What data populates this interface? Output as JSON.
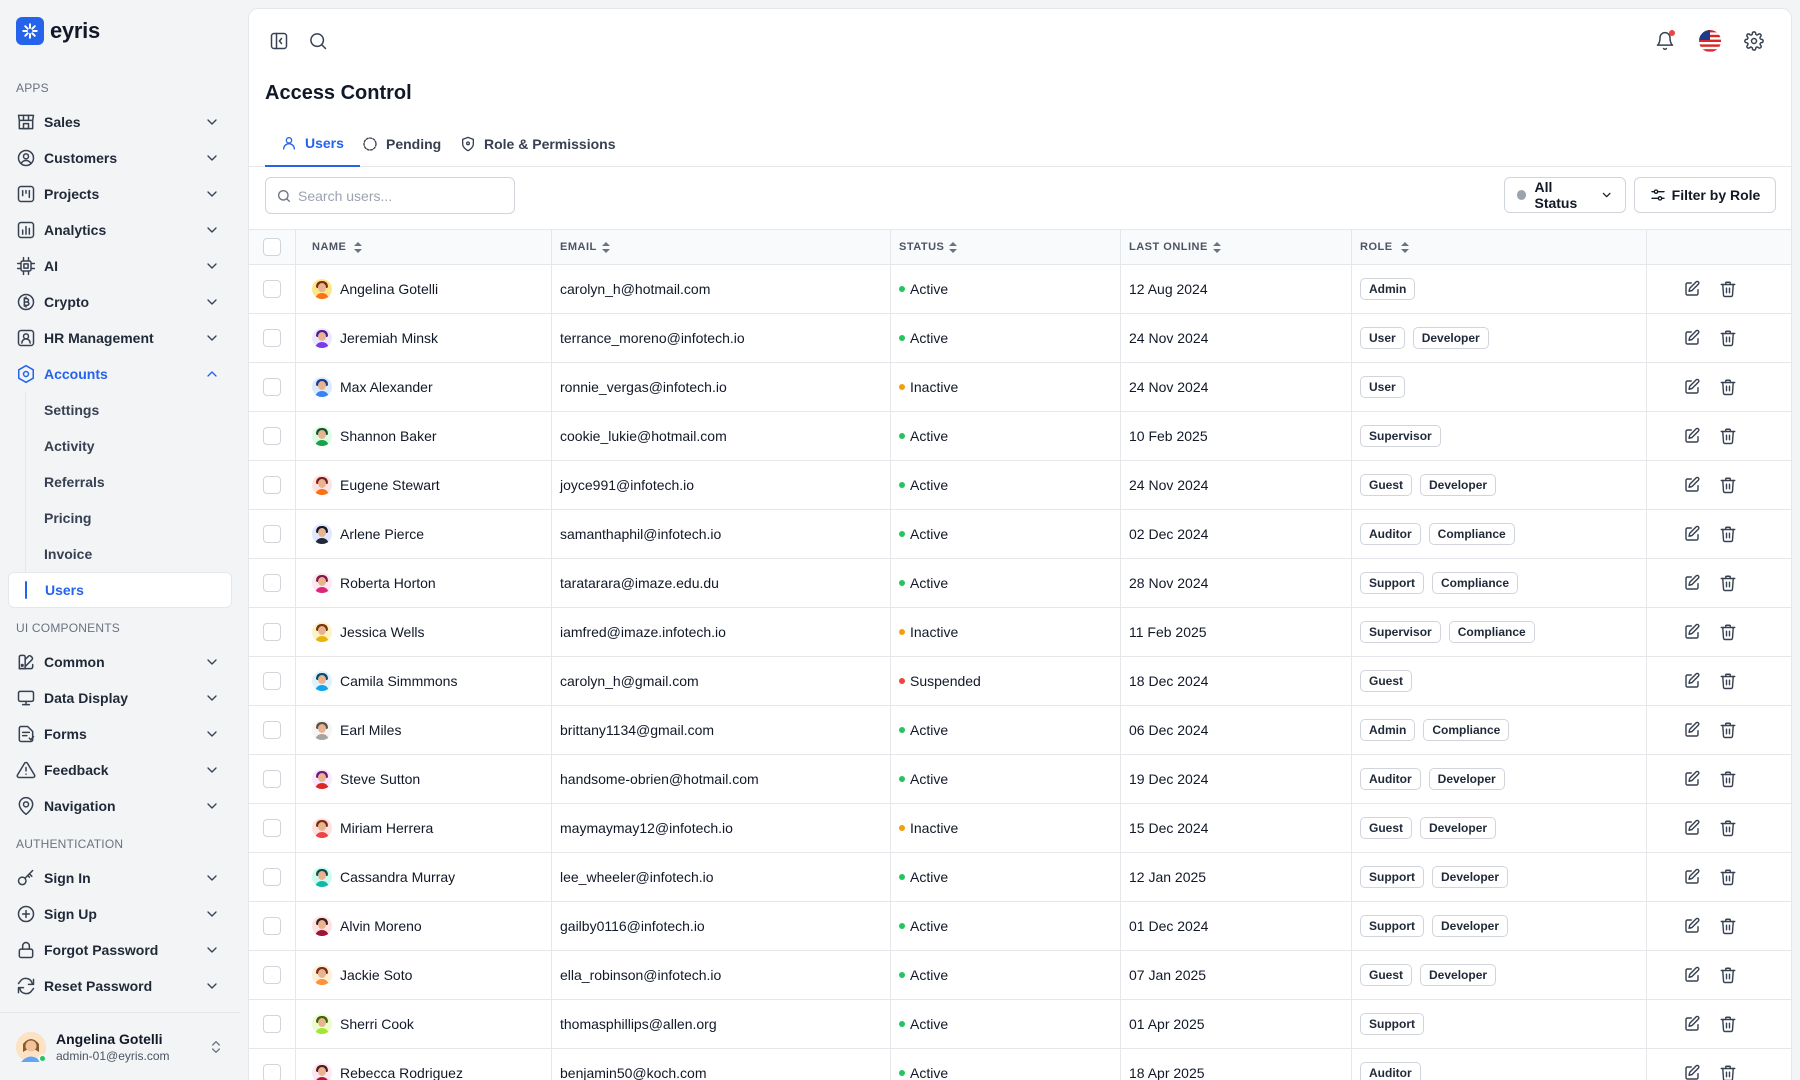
{
  "brand": {
    "name": "eyris"
  },
  "sidebar": {
    "sections": {
      "apps": "APPS",
      "ui_components": "UI COMPONENTS",
      "authentication": "AUTHENTICATION"
    },
    "apps": [
      {
        "label": "Sales",
        "icon": "store-icon"
      },
      {
        "label": "Customers",
        "icon": "user-circle-icon"
      },
      {
        "label": "Projects",
        "icon": "kanban-icon"
      },
      {
        "label": "Analytics",
        "icon": "bar-chart-icon"
      },
      {
        "label": "AI",
        "icon": "cpu-icon"
      },
      {
        "label": "Crypto",
        "icon": "bitcoin-icon"
      },
      {
        "label": "HR Management",
        "icon": "id-badge-icon"
      },
      {
        "label": "Accounts",
        "icon": "hexagon-icon",
        "expanded": true
      }
    ],
    "accounts_sub": [
      "Settings",
      "Activity",
      "Referrals",
      "Pricing",
      "Invoice",
      "Users"
    ],
    "active_sub": "Users",
    "ui_components": [
      {
        "label": "Common",
        "icon": "palette-icon"
      },
      {
        "label": "Data Display",
        "icon": "monitor-icon"
      },
      {
        "label": "Forms",
        "icon": "form-icon"
      },
      {
        "label": "Feedback",
        "icon": "alert-triangle-icon"
      },
      {
        "label": "Navigation",
        "icon": "map-pin-icon"
      }
    ],
    "authentication": [
      {
        "label": "Sign In",
        "icon": "key-icon"
      },
      {
        "label": "Sign Up",
        "icon": "plus-circle-icon"
      },
      {
        "label": "Forgot Password",
        "icon": "lock-icon"
      },
      {
        "label": "Reset Password",
        "icon": "refresh-icon"
      }
    ],
    "user": {
      "name": "Angelina Gotelli",
      "email": "admin-01@eyris.com"
    }
  },
  "header": {
    "icons": [
      "sidebar-toggle-icon",
      "search-icon",
      "bell-icon",
      "us-flag-icon",
      "gear-icon"
    ]
  },
  "page": {
    "title": "Access Control",
    "tabs": [
      {
        "label": "Users",
        "icon": "user-icon",
        "active": true
      },
      {
        "label": "Pending",
        "icon": "loader-icon",
        "active": false
      },
      {
        "label": "Role & Permissions",
        "icon": "shield-icon",
        "active": false
      }
    ]
  },
  "toolbar": {
    "search_placeholder": "Search users...",
    "status_filter": "All Status",
    "filter_button": "Filter by Role"
  },
  "table": {
    "columns": [
      "NAME",
      "EMAIL",
      "STATUS",
      "LAST ONLINE",
      "ROLE"
    ],
    "status_colors": {
      "Active": "#22c55e",
      "Inactive": "#f59e0b",
      "Suspended": "#ef4444"
    },
    "rows": [
      {
        "name": "Angelina Gotelli",
        "email": "carolyn_h@hotmail.com",
        "status": "Active",
        "last_online": "12 Aug 2024",
        "roles": [
          "Admin"
        ]
      },
      {
        "name": "Jeremiah Minsk",
        "email": "terrance_moreno@infotech.io",
        "status": "Active",
        "last_online": "24 Nov 2024",
        "roles": [
          "User",
          "Developer"
        ]
      },
      {
        "name": "Max Alexander",
        "email": "ronnie_vergas@infotech.io",
        "status": "Inactive",
        "last_online": "24 Nov 2024",
        "roles": [
          "User"
        ]
      },
      {
        "name": "Shannon Baker",
        "email": "cookie_lukie@hotmail.com",
        "status": "Active",
        "last_online": "10 Feb 2025",
        "roles": [
          "Supervisor"
        ]
      },
      {
        "name": "Eugene Stewart",
        "email": "joyce991@infotech.io",
        "status": "Active",
        "last_online": "24 Nov 2024",
        "roles": [
          "Guest",
          "Developer"
        ]
      },
      {
        "name": "Arlene Pierce",
        "email": "samanthaphil@infotech.io",
        "status": "Active",
        "last_online": "02 Dec 2024",
        "roles": [
          "Auditor",
          "Compliance"
        ]
      },
      {
        "name": "Roberta Horton",
        "email": "taratarara@imaze.edu.du",
        "status": "Active",
        "last_online": "28 Nov 2024",
        "roles": [
          "Support",
          "Compliance"
        ]
      },
      {
        "name": "Jessica Wells",
        "email": "iamfred@imaze.infotech.io",
        "status": "Inactive",
        "last_online": "11 Feb 2025",
        "roles": [
          "Supervisor",
          "Compliance"
        ]
      },
      {
        "name": "Camila Simmmons",
        "email": "carolyn_h@gmail.com",
        "status": "Suspended",
        "last_online": "18 Dec 2024",
        "roles": [
          "Guest"
        ]
      },
      {
        "name": "Earl Miles",
        "email": "brittany1134@gmail.com",
        "status": "Active",
        "last_online": "06 Dec 2024",
        "roles": [
          "Admin",
          "Compliance"
        ]
      },
      {
        "name": "Steve Sutton",
        "email": "handsome-obrien@hotmail.com",
        "status": "Active",
        "last_online": "19 Dec 2024",
        "roles": [
          "Auditor",
          "Developer"
        ]
      },
      {
        "name": "Miriam Herrera",
        "email": "maymaymay12@infotech.io",
        "status": "Inactive",
        "last_online": "15 Dec 2024",
        "roles": [
          "Guest",
          "Developer"
        ]
      },
      {
        "name": "Cassandra Murray",
        "email": "lee_wheeler@infotech.io",
        "status": "Active",
        "last_online": "12 Jan 2025",
        "roles": [
          "Support",
          "Developer"
        ]
      },
      {
        "name": "Alvin Moreno",
        "email": "gailby0116@infotech.io",
        "status": "Active",
        "last_online": "01 Dec 2024",
        "roles": [
          "Support",
          "Developer"
        ]
      },
      {
        "name": "Jackie Soto",
        "email": "ella_robinson@infotech.io",
        "status": "Active",
        "last_online": "07 Jan 2025",
        "roles": [
          "Guest",
          "Developer"
        ]
      },
      {
        "name": "Sherri Cook",
        "email": "thomasphillips@allen.org",
        "status": "Active",
        "last_online": "01 Apr 2025",
        "roles": [
          "Support"
        ]
      },
      {
        "name": "Rebecca Rodriguez",
        "email": "benjamin50@koch.com",
        "status": "Active",
        "last_online": "18 Apr 2025",
        "roles": [
          "Auditor"
        ]
      }
    ]
  },
  "colors": {
    "accent": "#2563eb",
    "border": "#e5e7eb",
    "muted": "#6b7280"
  }
}
